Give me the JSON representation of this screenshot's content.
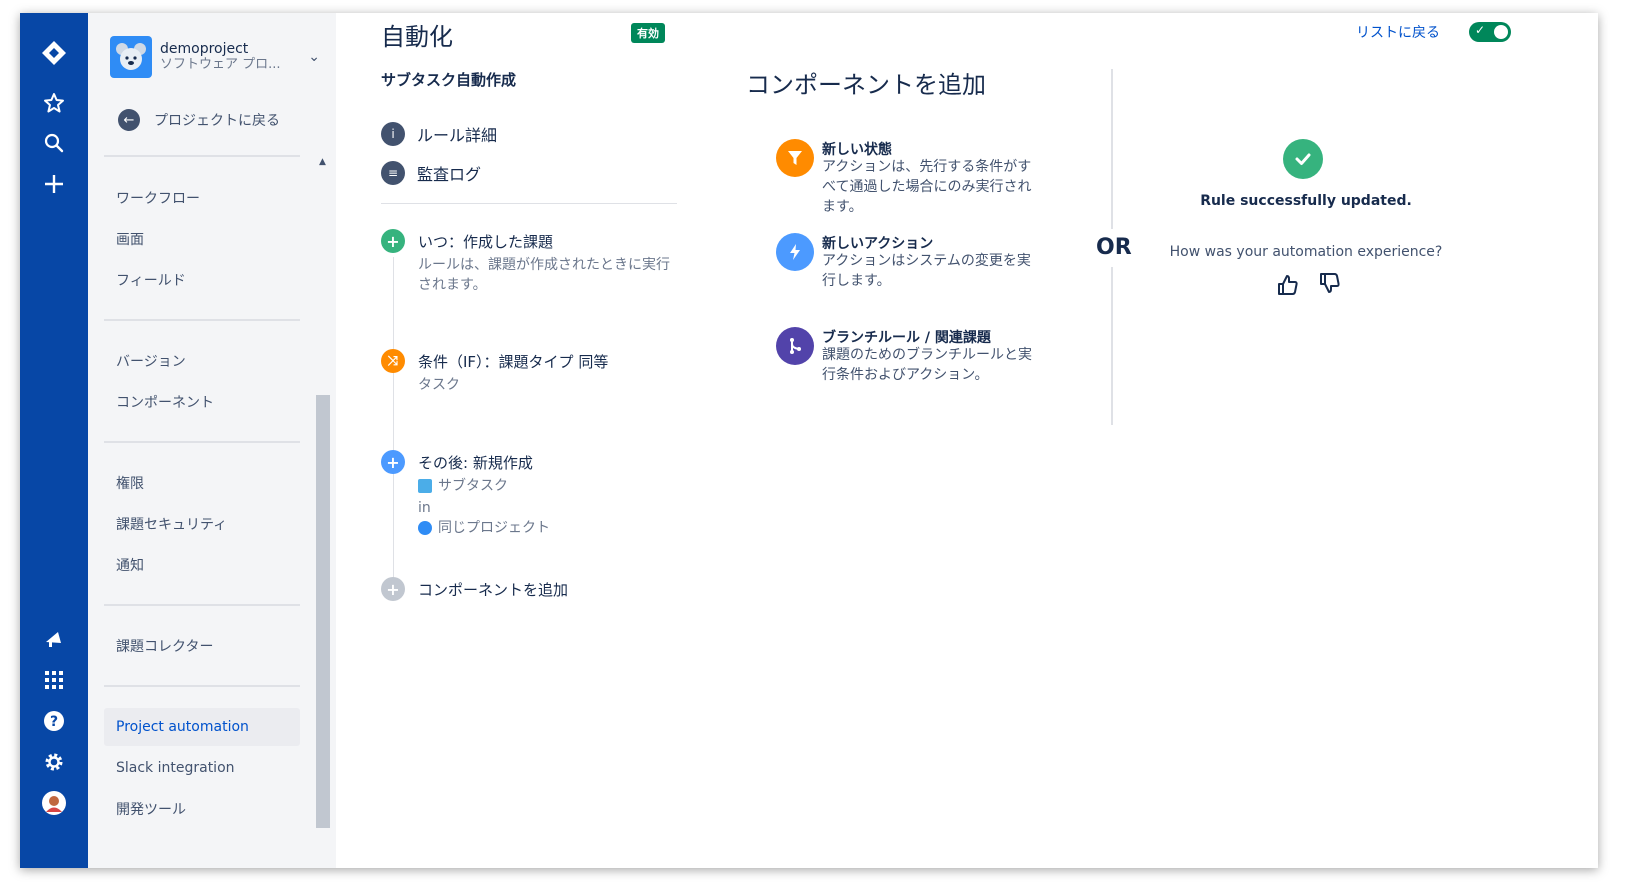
{
  "project": {
    "name": "demoproject",
    "type": "ソフトウェア プロ..."
  },
  "sidebar": {
    "back_label": "プロジェクトに戻る",
    "items": [
      {
        "label": "ワークフロー"
      },
      {
        "label": "画面"
      },
      {
        "label": "フィールド"
      },
      {
        "label": "バージョン"
      },
      {
        "label": "コンポーネント"
      },
      {
        "label": "権限"
      },
      {
        "label": "課題セキュリティ"
      },
      {
        "label": "通知"
      },
      {
        "label": "課題コレクター"
      },
      {
        "label": "Project automation"
      },
      {
        "label": "Slack integration"
      },
      {
        "label": "開発ツール"
      }
    ],
    "active_item": "Project automation"
  },
  "header": {
    "title": "自動化",
    "status_badge": "有効",
    "back_to_list": "リストに戻る"
  },
  "rule": {
    "name": "サブタスク自動作成",
    "details_label": "ルール詳細",
    "audit_label": "監査ログ",
    "trigger": {
      "title": "いつ：作成した課題",
      "description": "ルールは、課題が作成されたときに実行されます。"
    },
    "condition": {
      "title": "条件（IF）：課題タイプ 同等",
      "value": "タスク"
    },
    "action": {
      "title": "その後: 新規作成",
      "issue_type": "サブタスク",
      "in_label": "in",
      "project": "同じプロジェクト"
    },
    "add_component": "コンポーネントを追加"
  },
  "add_panel": {
    "title": "コンポーネントを追加",
    "options": [
      {
        "title": "新しい状態",
        "description": "アクションは、先行する条件がすべて通過した場合にのみ実行されます。"
      },
      {
        "title": "新しいアクション",
        "description": "アクションはシステムの変更を実行します。"
      },
      {
        "title": "ブランチルール / 関連課題",
        "description": "課題のためのブランチルールと実行条件およびアクション。"
      }
    ],
    "or_label": "OR"
  },
  "feedback": {
    "success": "Rule successfully updated.",
    "question": "How was your automation experience?"
  },
  "colors": {
    "nav_bg": "#0747a6",
    "accent": "#0052cc",
    "success": "#36b37e",
    "condition": "#ff8b00",
    "branch": "#5243aa",
    "action": "#4c9aff",
    "trigger": "#36b37e"
  }
}
